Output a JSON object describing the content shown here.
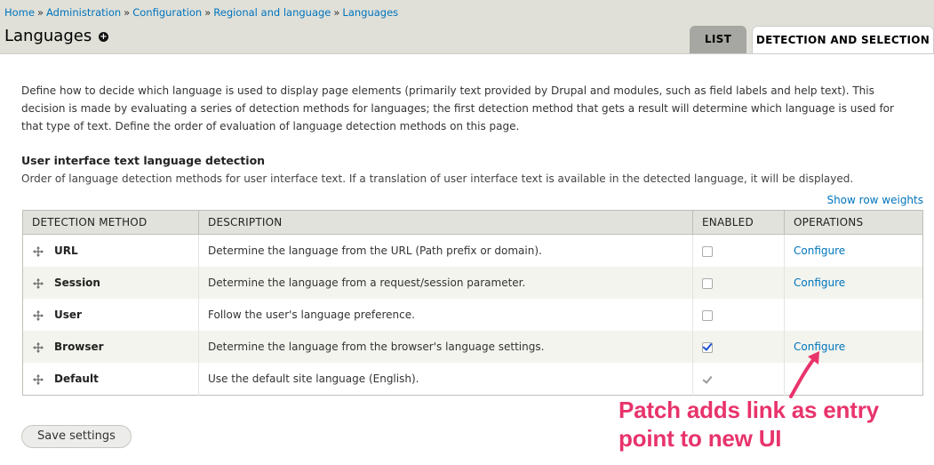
{
  "breadcrumb": {
    "items": [
      "Home",
      "Administration",
      "Configuration",
      "Regional and language",
      "Languages"
    ],
    "separator": "»"
  },
  "page": {
    "title": "Languages",
    "shortcut_icon": "plus-circle-icon"
  },
  "tabs": [
    {
      "label": "LIST",
      "active": false
    },
    {
      "label": "DETECTION AND SELECTION",
      "active": true
    }
  ],
  "intro": "Define how to decide which language is used to display page elements (primarily text provided by Drupal and modules, such as field labels and help text). This decision is made by evaluating a series of detection methods for languages; the first detection method that gets a result will determine which language is used for that type of text. Define the order of evaluation of language detection methods on this page.",
  "section": {
    "title": "User interface text language detection",
    "description": "Order of language detection methods for user interface text. If a translation of user interface text is available in the detected language, it will be displayed.",
    "row_weights_link": "Show row weights"
  },
  "table": {
    "headers": [
      "DETECTION METHOD",
      "DESCRIPTION",
      "ENABLED",
      "OPERATIONS"
    ],
    "rows": [
      {
        "method": "URL",
        "description": "Determine the language from the URL (Path prefix or domain).",
        "enabled": "unchecked",
        "operation": "Configure"
      },
      {
        "method": "Session",
        "description": "Determine the language from a request/session parameter.",
        "enabled": "unchecked",
        "operation": "Configure"
      },
      {
        "method": "User",
        "description": "Follow the user's language preference.",
        "enabled": "unchecked",
        "operation": ""
      },
      {
        "method": "Browser",
        "description": "Determine the language from the browser's language settings.",
        "enabled": "checked",
        "operation": "Configure"
      },
      {
        "method": "Default",
        "description": "Use the default site language (English).",
        "enabled": "disabled-checked",
        "operation": ""
      }
    ]
  },
  "buttons": {
    "save": "Save settings"
  },
  "annotation": {
    "line1": "Patch adds link as entry",
    "line2": "point to new UI",
    "color": "#e8336b"
  },
  "icons": {
    "drag": "drag-handle-icon",
    "arrow": "arrow-icon"
  }
}
